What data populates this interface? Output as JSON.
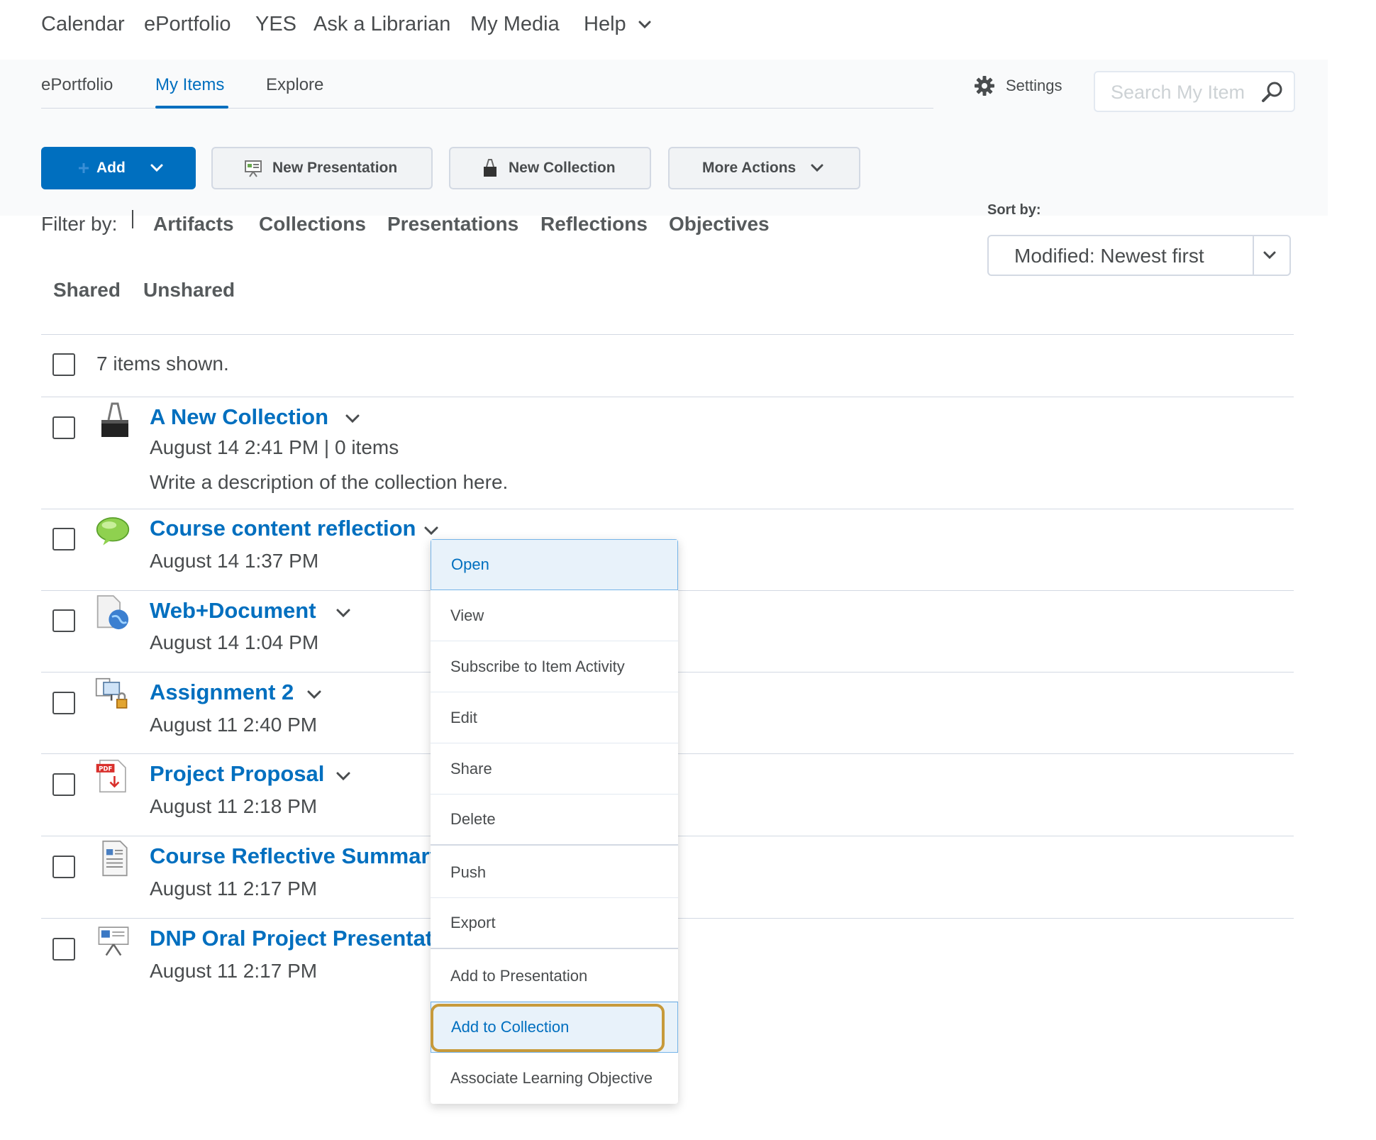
{
  "top_nav": [
    "Calendar",
    "ePortfolio",
    "YES",
    "Ask a Librarian",
    "My Media",
    "Help"
  ],
  "tabs": [
    "ePortfolio",
    "My Items",
    "Explore"
  ],
  "active_tab": "My Items",
  "settings_label": "Settings",
  "search": {
    "placeholder": "Search My Items"
  },
  "toolbar": {
    "add_label": "Add",
    "new_presentation_label": "New Presentation",
    "new_collection_label": "New Collection",
    "more_actions_label": "More Actions"
  },
  "filter": {
    "label": "Filter by:",
    "types": [
      "Artifacts",
      "Collections",
      "Presentations",
      "Reflections",
      "Objectives"
    ],
    "sharing": [
      "Shared",
      "Unshared"
    ]
  },
  "sort": {
    "label": "Sort by:",
    "value": "Modified: Newest first"
  },
  "count_text": "7 items shown.",
  "items": [
    {
      "title": "A New Collection",
      "meta": "August 14 2:41 PM | 0 items",
      "description": "Write a description of the collection here.",
      "icon": "collection-binder-icon"
    },
    {
      "title": "Course content reflection",
      "meta": "August 14 1:37 PM",
      "icon": "reflection-cloud-icon"
    },
    {
      "title": "Web+Document",
      "meta": "August 14 1:04 PM",
      "icon": "web-document-icon"
    },
    {
      "title": "Assignment 2",
      "meta": "August 11 2:40 PM",
      "icon": "locked-assignment-icon"
    },
    {
      "title": "Project Proposal",
      "meta": "August 11 2:18 PM",
      "icon": "pdf-file-icon"
    },
    {
      "title": "Course Reflective Summary",
      "meta": "August 11 2:17 PM",
      "icon": "document-file-icon"
    },
    {
      "title": "DNP Oral Project Presentation",
      "meta": "August 11 2:17 PM",
      "icon": "presentation-easel-icon"
    }
  ],
  "context_menu": {
    "items": [
      "Open",
      "View",
      "Subscribe to Item Activity",
      "Edit",
      "Share",
      "Delete",
      "Push",
      "Export",
      "Add to Presentation",
      "Add to Collection",
      "Associate Learning Objective"
    ],
    "hovered": "Open",
    "highlighted": "Add to Collection"
  },
  "colors": {
    "accent": "#006fbf",
    "highlight_ring": "#c79a3a",
    "text": "#494c4e"
  }
}
